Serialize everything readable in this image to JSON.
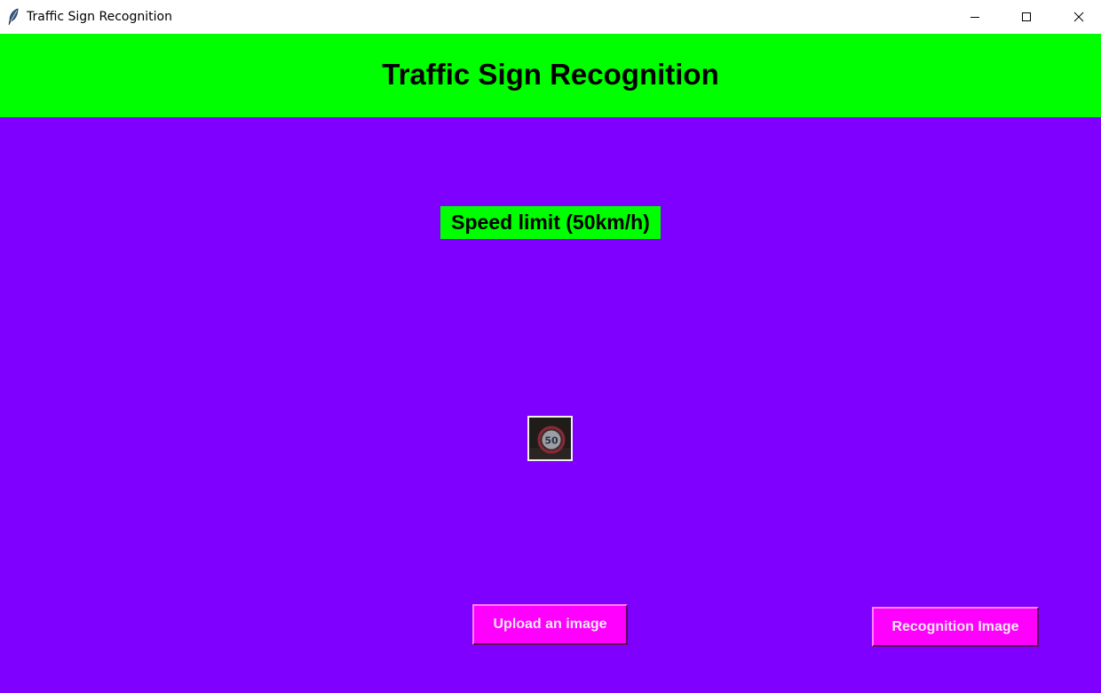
{
  "window": {
    "title": "Traffic Sign Recognition",
    "controls": {
      "minimize_icon": "minimize-icon",
      "maximize_icon": "maximize-icon",
      "close_icon": "close-icon"
    }
  },
  "header": {
    "heading": "Traffic Sign Recognition",
    "background": "#00ff00"
  },
  "main": {
    "background": "#8000ff",
    "result_label": "Speed limit (50km/h)",
    "result_background": "#00ff00",
    "uploaded_image": {
      "sign_text": "50",
      "icon": "speed-limit-sign-icon"
    }
  },
  "buttons": {
    "upload_label": "Upload an image",
    "recognize_label": "Recognition Image",
    "background": "#ff00ff"
  }
}
